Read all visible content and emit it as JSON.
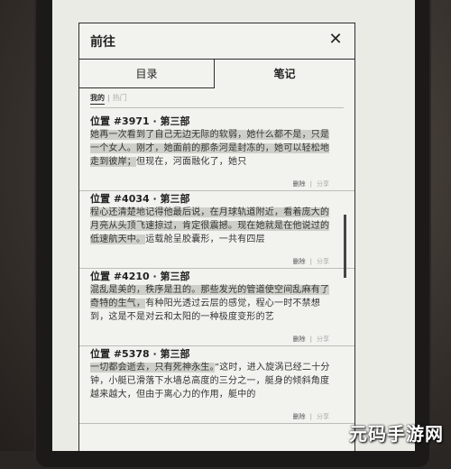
{
  "header": {
    "title": "前往",
    "close_symbol": "✕"
  },
  "tabs": [
    {
      "label": "目录",
      "active": false
    },
    {
      "label": "笔记",
      "active": true
    }
  ],
  "filter": {
    "mine": "我的",
    "separator": "|",
    "popular": "热门"
  },
  "notes": [
    {
      "location": "位置 #3971 · 第三部",
      "highlight": "她再一次看到了自己无边无际的软弱，她什么都不是，只是一个女人。刚才，她面前的那条河是封冻的，她可以轻松地走到彼岸；",
      "rest": "但现在，河面融化了，她只",
      "delete": "删除",
      "share": "分享"
    },
    {
      "location": "位置 #4034 · 第三部",
      "highlight": "程心还清楚地记得他最后说，在月球轨道附近，看着庞大的月亮从头顶飞速掠过，肯定很震撼。现在她就是在他说过的低速航天中。",
      "rest": "运载舱呈胶囊形，一共有四层",
      "delete": "删除",
      "share": "分享"
    },
    {
      "location": "位置 #4210 · 第三部",
      "highlight": "混乱是美的，秩序是丑的。那些发光的管道使空间乱麻有了奇特的生气，",
      "rest": "有种阳光透过云层的感觉，程心一时不禁想到，这是不是对云和太阳的一种极度变形的艺",
      "delete": "删除",
      "share": "分享"
    },
    {
      "location": "位置 #5378 · 第三部",
      "highlight": "一切都会逝去，只有死神永生。",
      "rest": "”这时，进入旋涡已经二十分钟，小艇已滑落下水墙总高度的三分之一，艇身的倾斜角度越来越大，但由于离心力的作用，艇中的",
      "delete": "删除",
      "share": "分享"
    }
  ],
  "watermark": "元码手游网"
}
